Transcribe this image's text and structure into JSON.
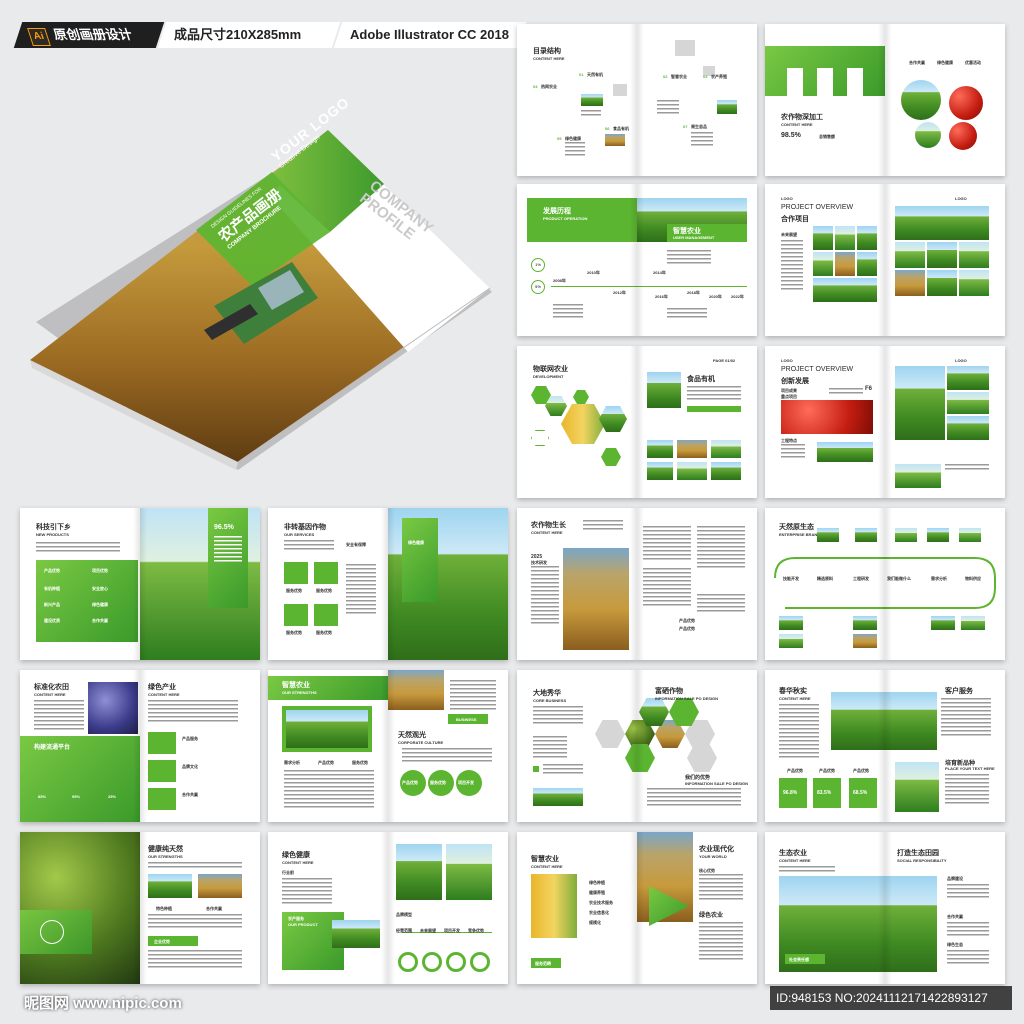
{
  "top_bar": {
    "ai_badge": "Ai",
    "label_1": "原创画册设计",
    "label_2": "成品尺寸210X285mm",
    "label_3": "Adobe Illustrator CC 2018"
  },
  "cover": {
    "logo": "YOUR LOGO",
    "logo_sub": "Creative Design",
    "guide": "DESIGN GUIDELINES FOR",
    "title_cn": "农产品画册",
    "title_en": "COMPANY BROCHURE",
    "company": "COMPANY",
    "profile": "PROFILE"
  },
  "spreads": {
    "s1": {
      "title": "目录结构",
      "sub": "CONTENT HERE",
      "labels": [
        "天然有机",
        "智慧农业",
        "农产养殖",
        "热网农业",
        "绿色健康",
        "食品有机",
        "周生态品"
      ],
      "numbers": [
        "01",
        "02",
        "03",
        "04",
        "05",
        "06",
        "07"
      ]
    },
    "s2": {
      "left_labels": [
        "生态水果",
        "智慧农业",
        "有机农业"
      ],
      "title": "农作物深加工",
      "sub": "CONTENT HERE",
      "stat": "98.5%",
      "stat_label": "总销售额",
      "right_labels": [
        "合作共赢",
        "绿色健康",
        "优惠活动"
      ]
    },
    "s3": {
      "title_left": "发展历程",
      "sub_left": "PRODUCT OPERATION",
      "title_right": "智慧农业",
      "sub_right": "USER MANAGEMENT",
      "years": [
        "2008年",
        "2010年",
        "2012年",
        "2014年",
        "2016年",
        "2018年",
        "2020年",
        "2022年"
      ],
      "badges": [
        "1%",
        "5%"
      ]
    },
    "s4": {
      "logo": "LOGO",
      "title": "PROJECT OVERVIEW",
      "sub": "合作项目",
      "label": "未来展望"
    },
    "s5": {
      "title": "物联网农业",
      "sub": "DEVELOPMENT",
      "page": "PAGE 01/02",
      "right_title": "食品有机"
    },
    "s6": {
      "logo": "LOGO",
      "title": "PROJECT OVERVIEW",
      "sub": "创新发展",
      "page": "F6",
      "labels": [
        "项目成果",
        "重点项目",
        "工程特点"
      ]
    },
    "s7": {
      "title": "科技引下乡",
      "sub": "NEW PRODUCTS",
      "stat": "96.5%",
      "list": [
        "产品优势",
        "项目优势",
        "有机种植",
        "安全放心",
        "新兴产品",
        "绿色健康",
        "建设优质",
        "合作共赢"
      ]
    },
    "s8": {
      "title": "非转基因作物",
      "sub": "OUR SERVICES",
      "right_label": "绿色健康",
      "left_label": "安全有保障",
      "items": [
        "服务优势",
        "服务优势",
        "服务优势",
        "服务优势"
      ]
    },
    "s9": {
      "title": "农作物生长",
      "sub": "CONTENT HERE",
      "year": "2025",
      "label": "技术研发",
      "list": [
        "产品优势",
        "产品优势"
      ]
    },
    "s10": {
      "title": "天然原生态",
      "sub": "ENTERPRISE BRAND",
      "steps": [
        "技能开发",
        "精选原料",
        "工程研发",
        "我们能做什么",
        "需求分析",
        "物料供应"
      ]
    },
    "s11": {
      "title": "标准化农田",
      "sub": "CONTENT HERE",
      "right_title": "绿色产业",
      "right_sub": "CONTENT HERE",
      "platform": "构建流通平台",
      "stats": [
        "85%",
        "95%",
        "25%"
      ],
      "list": [
        "产品服务",
        "品牌文化",
        "合作共赢"
      ]
    },
    "s12": {
      "title": "智慧农业",
      "sub": "OUR STRENGTHS",
      "business": "BUSINESS",
      "title2": "天然观光",
      "sub2": "CORPORATE CULTURE",
      "labels": [
        "需求分析",
        "产品优势",
        "服务优势"
      ],
      "list": [
        "产品优势",
        "服务优势",
        "项目开发"
      ]
    },
    "s13": {
      "title": "大地秀华",
      "sub": "CORE BUSINESS",
      "right_title": "富硒作物",
      "right_sub": "INFORMATION SALE PO DESIGN",
      "right_title2": "我们的优势",
      "right_sub2": "INFORMATION SALE PO DESIGN"
    },
    "s14": {
      "title": "春华秋实",
      "sub": "CONTENT HERE",
      "right_title": "客户服务",
      "stats": [
        "96.8%",
        "83.5%",
        "68.5%"
      ],
      "labels": [
        "产品优势",
        "产品优势",
        "产品优势"
      ],
      "right_title2": "培育新品种",
      "right_sub2": "PLACE YOUR TEXT HERE"
    },
    "s15": {
      "title": "健康纯天然",
      "sub": "OUR STRENGTHS",
      "list": [
        "特色种植",
        "合作共赢"
      ],
      "badge": "企业优势"
    },
    "s16": {
      "title": "绿色健康",
      "sub": "CONTENT HERE",
      "label": "行业前",
      "card_title": "农产服务",
      "card_sub": "OUR PRODUCT",
      "steps": [
        "经营范围",
        "未来展望",
        "项目开发",
        "竞争优势"
      ],
      "label2": "品牌模型"
    },
    "s17": {
      "title": "智慧农业",
      "sub": "CONTENT HERE",
      "right_title": "农业现代化",
      "right_sub": "YOUR WORLD",
      "list": [
        "绿色种植",
        "健康养殖",
        "农业技术服务",
        "农业信息化",
        "规模化"
      ],
      "label": "服务范畴",
      "label2": "核心优势",
      "label3": "绿色农业"
    },
    "s18": {
      "title": "生态农业",
      "sub": "CONTENT HERE",
      "right_title": "打造生态田园",
      "right_sub": "SOCIAL RESPONSIBILITY",
      "list": [
        "品牌建设",
        "合作共赢",
        "绿色生态"
      ],
      "badge": "社会责任感"
    }
  },
  "footer": {
    "watermark": "昵图网 www.nipic.com",
    "id": "ID:948153 NO:20241112171422893127"
  }
}
